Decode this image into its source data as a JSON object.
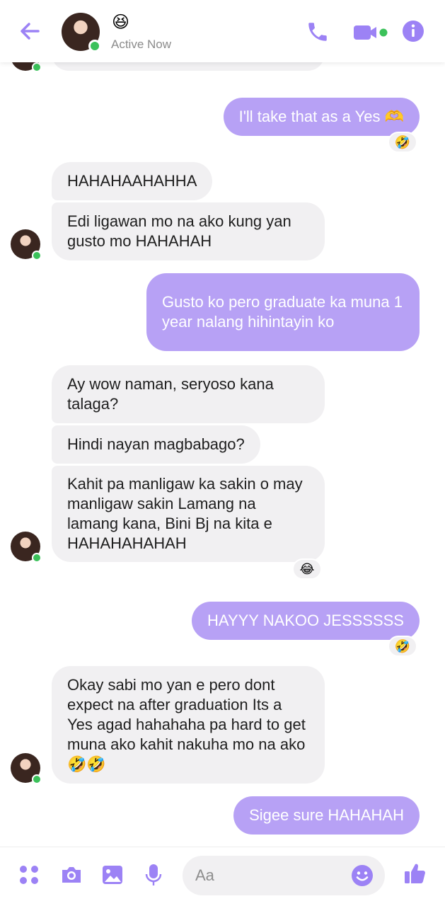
{
  "header": {
    "status_emoji": "😆",
    "status_text": "Active Now"
  },
  "messages": [
    {
      "id": "m1",
      "sender": "me",
      "text": "I'll take that as a Yes 🫶",
      "reaction": "🤣"
    },
    {
      "id": "m2",
      "sender": "them",
      "text": "HAHAHAAHAHHA"
    },
    {
      "id": "m3",
      "sender": "them",
      "text": "Edi ligawan mo na ako kung yan gusto mo HAHAHAH"
    },
    {
      "id": "m4",
      "sender": "me",
      "text": "Gusto ko pero graduate ka muna 1 year nalang hihintayin ko"
    },
    {
      "id": "m5",
      "sender": "them",
      "text": "Ay wow naman, seryoso kana talaga?"
    },
    {
      "id": "m6",
      "sender": "them",
      "text": "Hindi nayan magbabago?"
    },
    {
      "id": "m7",
      "sender": "them",
      "text": "Kahit pa manligaw ka sakin o may manligaw sakin Lamang na lamang kana, Bini Bj na kita e HAHAHAHAHAH",
      "reaction": "😂"
    },
    {
      "id": "m8",
      "sender": "me",
      "text": "HAYYY NAKOO JESSSSSS",
      "reaction": "🤣"
    },
    {
      "id": "m9",
      "sender": "them",
      "text": "Okay sabi mo yan e pero dont expect na after graduation Its a Yes agad hahahaha pa hard to get muna ako kahit nakuha mo na ako 🤣🤣"
    },
    {
      "id": "m10",
      "sender": "me",
      "text": "Sigee sure HAHAHAH"
    }
  ],
  "composer": {
    "placeholder": "Aa"
  },
  "colors": {
    "accent": "#9c82f5",
    "outgoing_bubble": "#b7a1f5",
    "incoming_bubble": "#f1f0f2",
    "online": "#3bc15a"
  }
}
